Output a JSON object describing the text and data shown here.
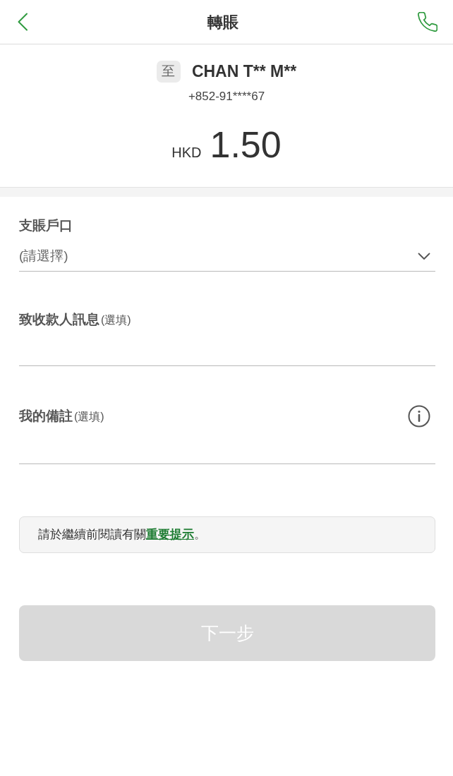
{
  "header": {
    "title": "轉賬"
  },
  "recipient": {
    "prefix": "至",
    "name": "CHAN T** M**",
    "phone": "+852-91****67"
  },
  "amount": {
    "currency": "HKD",
    "value": "1.50"
  },
  "fields": [
    {
      "kind": "select",
      "label": "支賬戶口",
      "placeholder": "(請選擇)"
    },
    {
      "kind": "text",
      "label": "致收款人訊息",
      "note": "(選填)"
    },
    {
      "kind": "text",
      "label": "我的備註",
      "note": "(選填)",
      "info": true
    }
  ],
  "notice": {
    "text": "請於繼續前閱讀有關",
    "link": "重要提示",
    "end": "。"
  },
  "next_button": {
    "label": "下一步",
    "disabled": true
  }
}
